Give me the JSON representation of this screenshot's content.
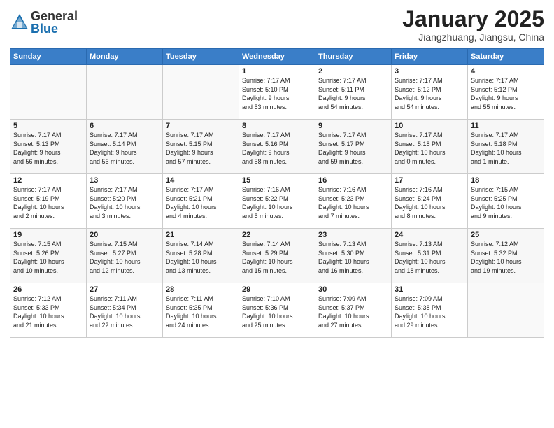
{
  "logo": {
    "general": "General",
    "blue": "Blue"
  },
  "title": "January 2025",
  "location": "Jiangzhuang, Jiangsu, China",
  "days_of_week": [
    "Sunday",
    "Monday",
    "Tuesday",
    "Wednesday",
    "Thursday",
    "Friday",
    "Saturday"
  ],
  "weeks": [
    [
      {
        "day": "",
        "info": ""
      },
      {
        "day": "",
        "info": ""
      },
      {
        "day": "",
        "info": ""
      },
      {
        "day": "1",
        "info": "Sunrise: 7:17 AM\nSunset: 5:10 PM\nDaylight: 9 hours\nand 53 minutes."
      },
      {
        "day": "2",
        "info": "Sunrise: 7:17 AM\nSunset: 5:11 PM\nDaylight: 9 hours\nand 54 minutes."
      },
      {
        "day": "3",
        "info": "Sunrise: 7:17 AM\nSunset: 5:12 PM\nDaylight: 9 hours\nand 54 minutes."
      },
      {
        "day": "4",
        "info": "Sunrise: 7:17 AM\nSunset: 5:12 PM\nDaylight: 9 hours\nand 55 minutes."
      }
    ],
    [
      {
        "day": "5",
        "info": "Sunrise: 7:17 AM\nSunset: 5:13 PM\nDaylight: 9 hours\nand 56 minutes."
      },
      {
        "day": "6",
        "info": "Sunrise: 7:17 AM\nSunset: 5:14 PM\nDaylight: 9 hours\nand 56 minutes."
      },
      {
        "day": "7",
        "info": "Sunrise: 7:17 AM\nSunset: 5:15 PM\nDaylight: 9 hours\nand 57 minutes."
      },
      {
        "day": "8",
        "info": "Sunrise: 7:17 AM\nSunset: 5:16 PM\nDaylight: 9 hours\nand 58 minutes."
      },
      {
        "day": "9",
        "info": "Sunrise: 7:17 AM\nSunset: 5:17 PM\nDaylight: 9 hours\nand 59 minutes."
      },
      {
        "day": "10",
        "info": "Sunrise: 7:17 AM\nSunset: 5:18 PM\nDaylight: 10 hours\nand 0 minutes."
      },
      {
        "day": "11",
        "info": "Sunrise: 7:17 AM\nSunset: 5:18 PM\nDaylight: 10 hours\nand 1 minute."
      }
    ],
    [
      {
        "day": "12",
        "info": "Sunrise: 7:17 AM\nSunset: 5:19 PM\nDaylight: 10 hours\nand 2 minutes."
      },
      {
        "day": "13",
        "info": "Sunrise: 7:17 AM\nSunset: 5:20 PM\nDaylight: 10 hours\nand 3 minutes."
      },
      {
        "day": "14",
        "info": "Sunrise: 7:17 AM\nSunset: 5:21 PM\nDaylight: 10 hours\nand 4 minutes."
      },
      {
        "day": "15",
        "info": "Sunrise: 7:16 AM\nSunset: 5:22 PM\nDaylight: 10 hours\nand 5 minutes."
      },
      {
        "day": "16",
        "info": "Sunrise: 7:16 AM\nSunset: 5:23 PM\nDaylight: 10 hours\nand 7 minutes."
      },
      {
        "day": "17",
        "info": "Sunrise: 7:16 AM\nSunset: 5:24 PM\nDaylight: 10 hours\nand 8 minutes."
      },
      {
        "day": "18",
        "info": "Sunrise: 7:15 AM\nSunset: 5:25 PM\nDaylight: 10 hours\nand 9 minutes."
      }
    ],
    [
      {
        "day": "19",
        "info": "Sunrise: 7:15 AM\nSunset: 5:26 PM\nDaylight: 10 hours\nand 10 minutes."
      },
      {
        "day": "20",
        "info": "Sunrise: 7:15 AM\nSunset: 5:27 PM\nDaylight: 10 hours\nand 12 minutes."
      },
      {
        "day": "21",
        "info": "Sunrise: 7:14 AM\nSunset: 5:28 PM\nDaylight: 10 hours\nand 13 minutes."
      },
      {
        "day": "22",
        "info": "Sunrise: 7:14 AM\nSunset: 5:29 PM\nDaylight: 10 hours\nand 15 minutes."
      },
      {
        "day": "23",
        "info": "Sunrise: 7:13 AM\nSunset: 5:30 PM\nDaylight: 10 hours\nand 16 minutes."
      },
      {
        "day": "24",
        "info": "Sunrise: 7:13 AM\nSunset: 5:31 PM\nDaylight: 10 hours\nand 18 minutes."
      },
      {
        "day": "25",
        "info": "Sunrise: 7:12 AM\nSunset: 5:32 PM\nDaylight: 10 hours\nand 19 minutes."
      }
    ],
    [
      {
        "day": "26",
        "info": "Sunrise: 7:12 AM\nSunset: 5:33 PM\nDaylight: 10 hours\nand 21 minutes."
      },
      {
        "day": "27",
        "info": "Sunrise: 7:11 AM\nSunset: 5:34 PM\nDaylight: 10 hours\nand 22 minutes."
      },
      {
        "day": "28",
        "info": "Sunrise: 7:11 AM\nSunset: 5:35 PM\nDaylight: 10 hours\nand 24 minutes."
      },
      {
        "day": "29",
        "info": "Sunrise: 7:10 AM\nSunset: 5:36 PM\nDaylight: 10 hours\nand 25 minutes."
      },
      {
        "day": "30",
        "info": "Sunrise: 7:09 AM\nSunset: 5:37 PM\nDaylight: 10 hours\nand 27 minutes."
      },
      {
        "day": "31",
        "info": "Sunrise: 7:09 AM\nSunset: 5:38 PM\nDaylight: 10 hours\nand 29 minutes."
      },
      {
        "day": "",
        "info": ""
      }
    ]
  ]
}
